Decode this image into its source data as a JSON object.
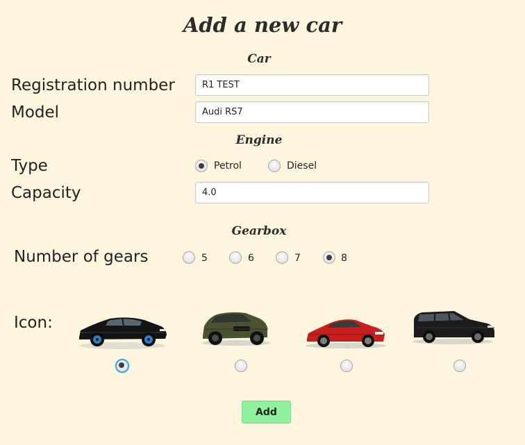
{
  "form": {
    "title": "Add a new car",
    "add_label": "Add"
  },
  "car_section": {
    "heading": "Car",
    "registration": {
      "label": "Registration number",
      "value": "R1 TEST"
    },
    "model": {
      "label": "Model",
      "value": "Audi RS7"
    }
  },
  "engine_section": {
    "heading": "Engine",
    "type_label": "Type",
    "type_options": [
      {
        "label": "Petrol",
        "selected": true
      },
      {
        "label": "Diesel",
        "selected": false
      }
    ],
    "capacity": {
      "label": "Capacity",
      "value": "4.0"
    }
  },
  "gearbox_section": {
    "heading": "Gearbox",
    "gears_label": "Number of gears",
    "gear_options": [
      {
        "label": "5",
        "selected": false
      },
      {
        "label": "6",
        "selected": false
      },
      {
        "label": "7",
        "selected": false
      },
      {
        "label": "8",
        "selected": true
      }
    ]
  },
  "icon_section": {
    "label": "Icon:",
    "icons": [
      {
        "icon": "audi-rs7-icon",
        "color": "#141414",
        "selected": true
      },
      {
        "icon": "bmw-x6-icon",
        "color": "#4a5230",
        "selected": false
      },
      {
        "icon": "mercedes-coupe-icon",
        "color": "#c81e1e",
        "selected": false
      },
      {
        "icon": "vw-passat-estate-icon",
        "color": "#1c1c1c",
        "selected": false
      }
    ]
  },
  "colors": {
    "background": "#fdf5dd",
    "add_button": "#8ff19e",
    "focus_ring": "#3fa6d8"
  }
}
